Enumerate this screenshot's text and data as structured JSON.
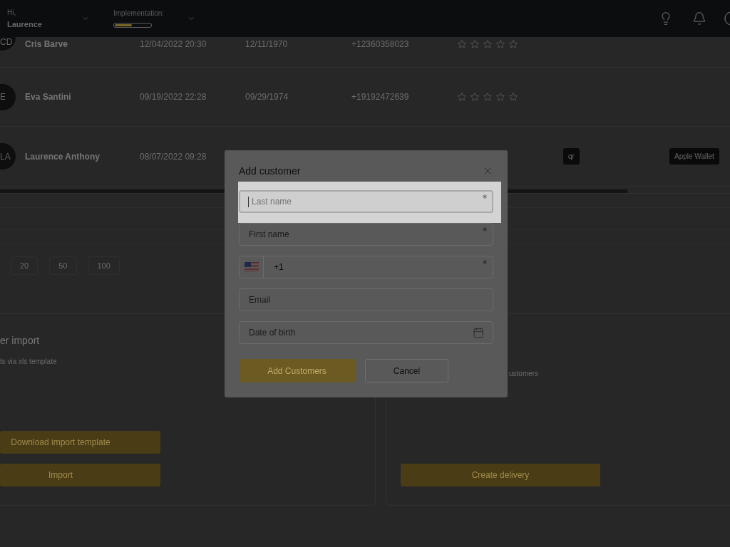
{
  "header": {
    "greeting": "Hi,",
    "user_name": "Laurence",
    "implementation": {
      "label": "Implementation:",
      "level": 0.47
    }
  },
  "customers": {
    "rows": [
      {
        "initials": "CD",
        "name": "Cris Barve",
        "created": "12/04/2022 20:30",
        "birth_date": "12/11/1970",
        "phone": "+12360358023",
        "stars": 0
      },
      {
        "initials": "E",
        "name": "Eva Santini",
        "created": "09/19/2022 22:28",
        "birth_date": "09/29/1974",
        "phone": "+19192472639",
        "stars": 0
      },
      {
        "initials": "LA",
        "name": "Laurence Anthony",
        "created": "08/07/2022 09:28",
        "badges": [
          "qr",
          "Apple Wallet"
        ]
      }
    ]
  },
  "page_sizes": [
    "20",
    "50",
    "100"
  ],
  "import_card": {
    "title": "er import",
    "subtitle": "ts via xls template",
    "buttons": [
      "Download import template",
      "Import"
    ]
  },
  "delivery_card": {
    "subtitle": "ustomers",
    "button": "Create delivery"
  },
  "dialog": {
    "title": "Add customer",
    "fields": [
      {
        "kind": "text",
        "placeholder": "Last name",
        "required": true,
        "focused": true,
        "highlighted": true
      },
      {
        "kind": "text",
        "placeholder": "First name",
        "required": true,
        "focused": false,
        "highlighted": false
      },
      {
        "kind": "phone",
        "value": "+1",
        "required": true,
        "focused": false,
        "highlighted": false
      },
      {
        "kind": "text",
        "placeholder": "Email",
        "required": false,
        "focused": false,
        "highlighted": false
      },
      {
        "kind": "date",
        "placeholder": "Date of birth",
        "required": false,
        "focused": false,
        "highlighted": false
      }
    ],
    "buttons": [
      {
        "kind": "primary",
        "label": "Add Customers"
      },
      {
        "kind": "secondary",
        "label": "Cancel"
      }
    ]
  }
}
